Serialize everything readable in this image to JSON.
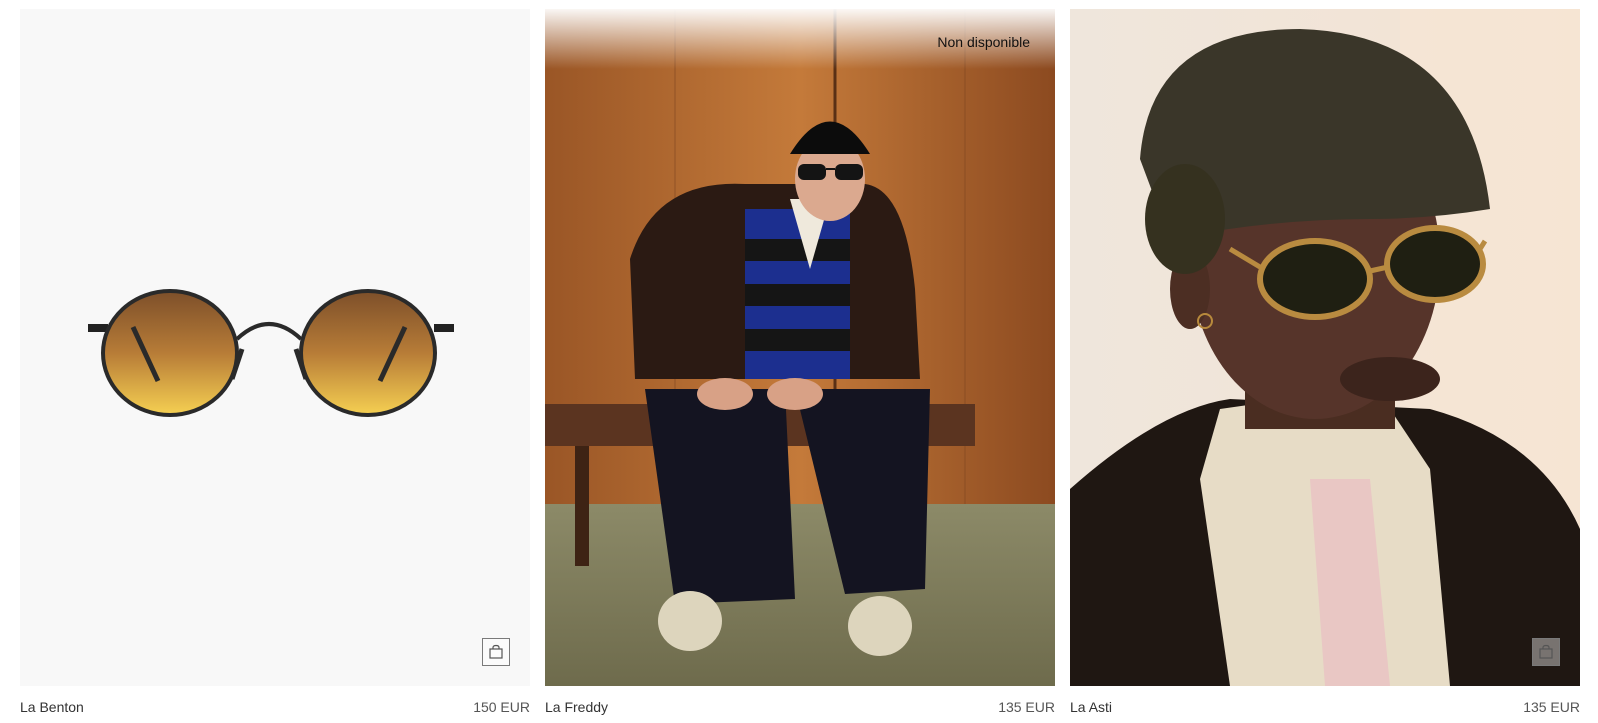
{
  "products": [
    {
      "name": "La Benton",
      "price": "150 EUR",
      "badge": "",
      "image_icon": "glasses-icon"
    },
    {
      "name": "La Freddy",
      "price": "135 EUR",
      "badge": "Non disponible",
      "image_icon": "photo-icon"
    },
    {
      "name": "La Asti",
      "price": "135 EUR",
      "badge": "",
      "image_icon": "photo-icon"
    }
  ],
  "icons": {
    "add_to_bag": "shopping-bag-icon"
  },
  "colors": {
    "lens_top": "#8a5a2e",
    "lens_bottom": "#f1c84a",
    "frame": "#2a2a2a",
    "wood": "#b06a30",
    "fur_hat": "#3d3a2c",
    "jacket": "#2b1c14",
    "backdrop": "#f2e9e0"
  }
}
